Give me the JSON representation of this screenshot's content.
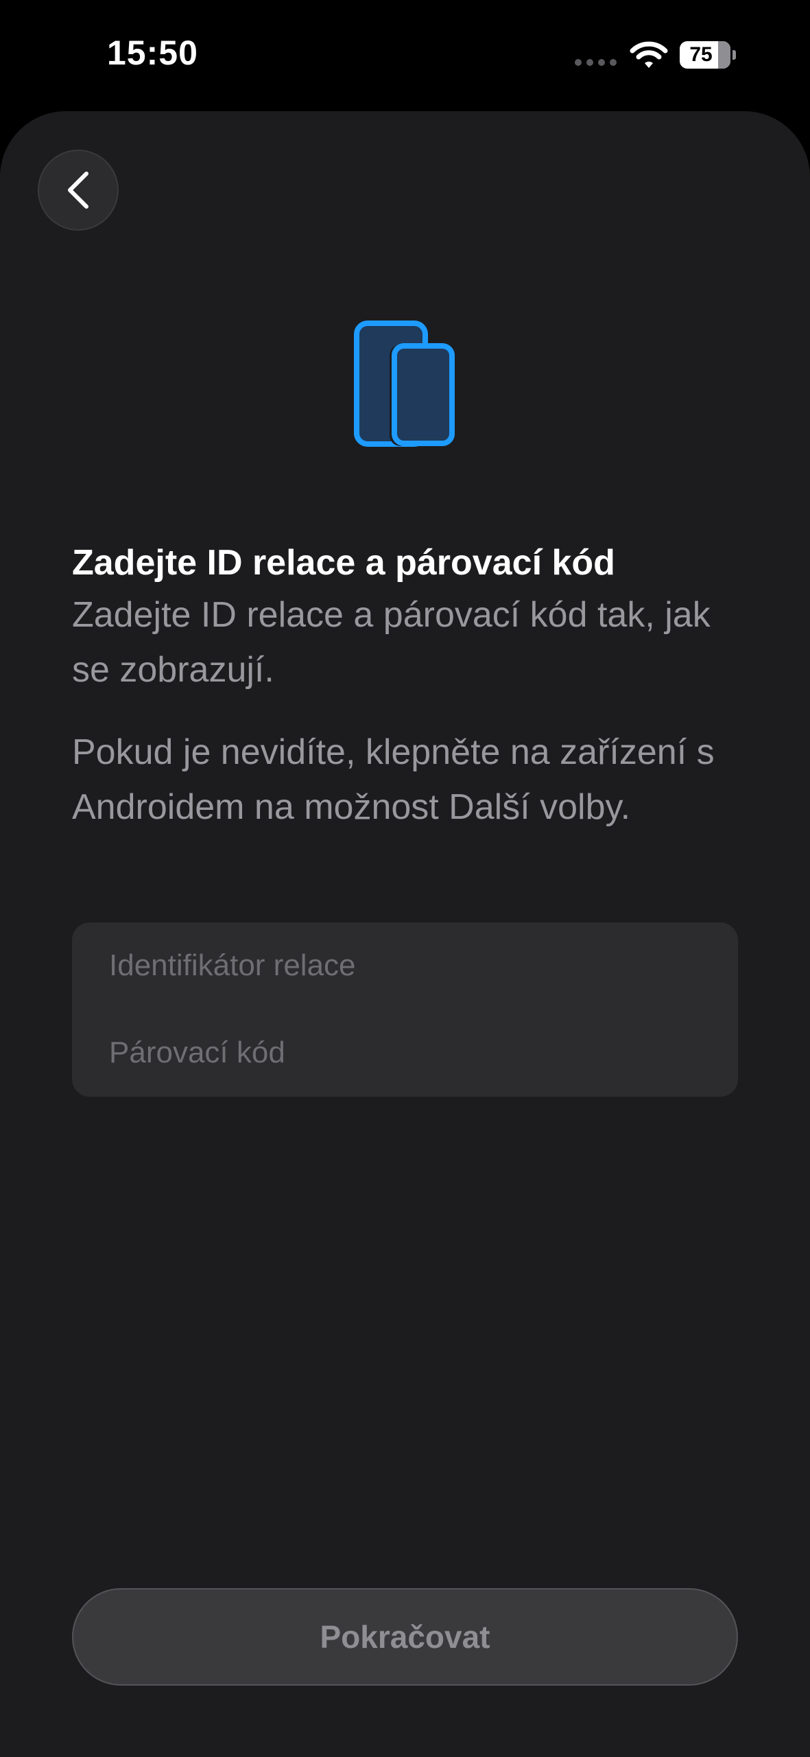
{
  "status_bar": {
    "time": "15:50",
    "battery_percent": 75,
    "battery_label": "75",
    "icons": [
      "signal-icon",
      "wifi-icon",
      "battery-icon"
    ]
  },
  "header": {
    "back_icon": "chevron-left-icon"
  },
  "illustration": {
    "icon": "devices-icon",
    "accent": "#1e9bff",
    "fill": "#1f3a5a"
  },
  "content": {
    "title": "Zadejte ID relace a párovací kód",
    "subtitle": "Zadejte ID relace a párovací kód tak, jak se zobrazují.",
    "hint": "Pokud je nevidíte, klepněte na zařízení s Androidem na možnost Další volby."
  },
  "form": {
    "session_id": {
      "value": "",
      "placeholder": "Identifikátor relace"
    },
    "pairing_code": {
      "value": "",
      "placeholder": "Párovací kód"
    }
  },
  "footer": {
    "continue_label": "Pokračovat",
    "continue_enabled": false
  },
  "colors": {
    "background": "#1c1c1e",
    "card": "#2c2c2e",
    "secondary_text": "#98989d",
    "disabled_button": "#3a3a3c"
  }
}
